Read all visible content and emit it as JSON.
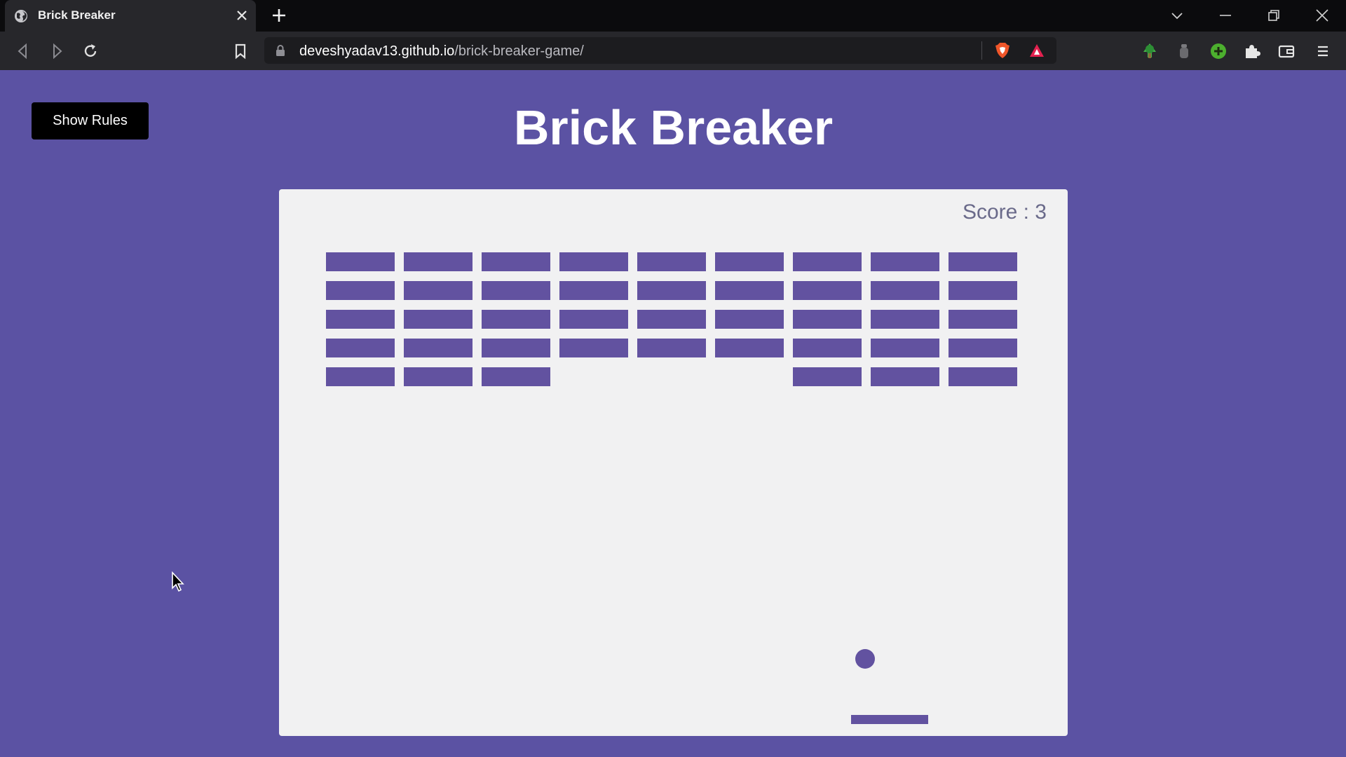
{
  "browser": {
    "tab_title": "Brick Breaker",
    "url_host": "deveshyadav13.github.io",
    "url_path": "/brick-breaker-game/",
    "icons": [
      "globe-icon",
      "close-icon",
      "plus-icon",
      "chevron-down-icon",
      "minimize-icon",
      "restore-icon",
      "window-close-icon",
      "back-icon",
      "forward-icon",
      "reload-icon",
      "bookmark-icon",
      "lock-icon",
      "brave-shield-icon",
      "brave-rewards-icon",
      "extension-tree-icon",
      "extension-grey-icon",
      "extension-plus-icon",
      "puzzle-icon",
      "wallet-icon",
      "menu-icon"
    ]
  },
  "page": {
    "title": "Brick Breaker",
    "rules_button": "Show Rules"
  },
  "game": {
    "score_label": "Score : 3",
    "score": 3,
    "brick_rows": 5,
    "brick_columns": 9,
    "brick_color": "#6252a0",
    "bricks_present": [
      [
        true,
        true,
        true,
        true,
        true,
        true,
        true,
        true,
        true
      ],
      [
        true,
        true,
        true,
        true,
        true,
        true,
        true,
        true,
        true
      ],
      [
        true,
        true,
        true,
        true,
        true,
        true,
        true,
        true,
        true
      ],
      [
        true,
        true,
        true,
        true,
        true,
        true,
        true,
        true,
        true
      ],
      [
        true,
        true,
        true,
        false,
        false,
        false,
        true,
        true,
        true
      ]
    ]
  },
  "colors": {
    "page_background": "#5b52a3",
    "game_background": "#f1f1f2",
    "button_background": "#000000",
    "accent": "#6252a0"
  }
}
